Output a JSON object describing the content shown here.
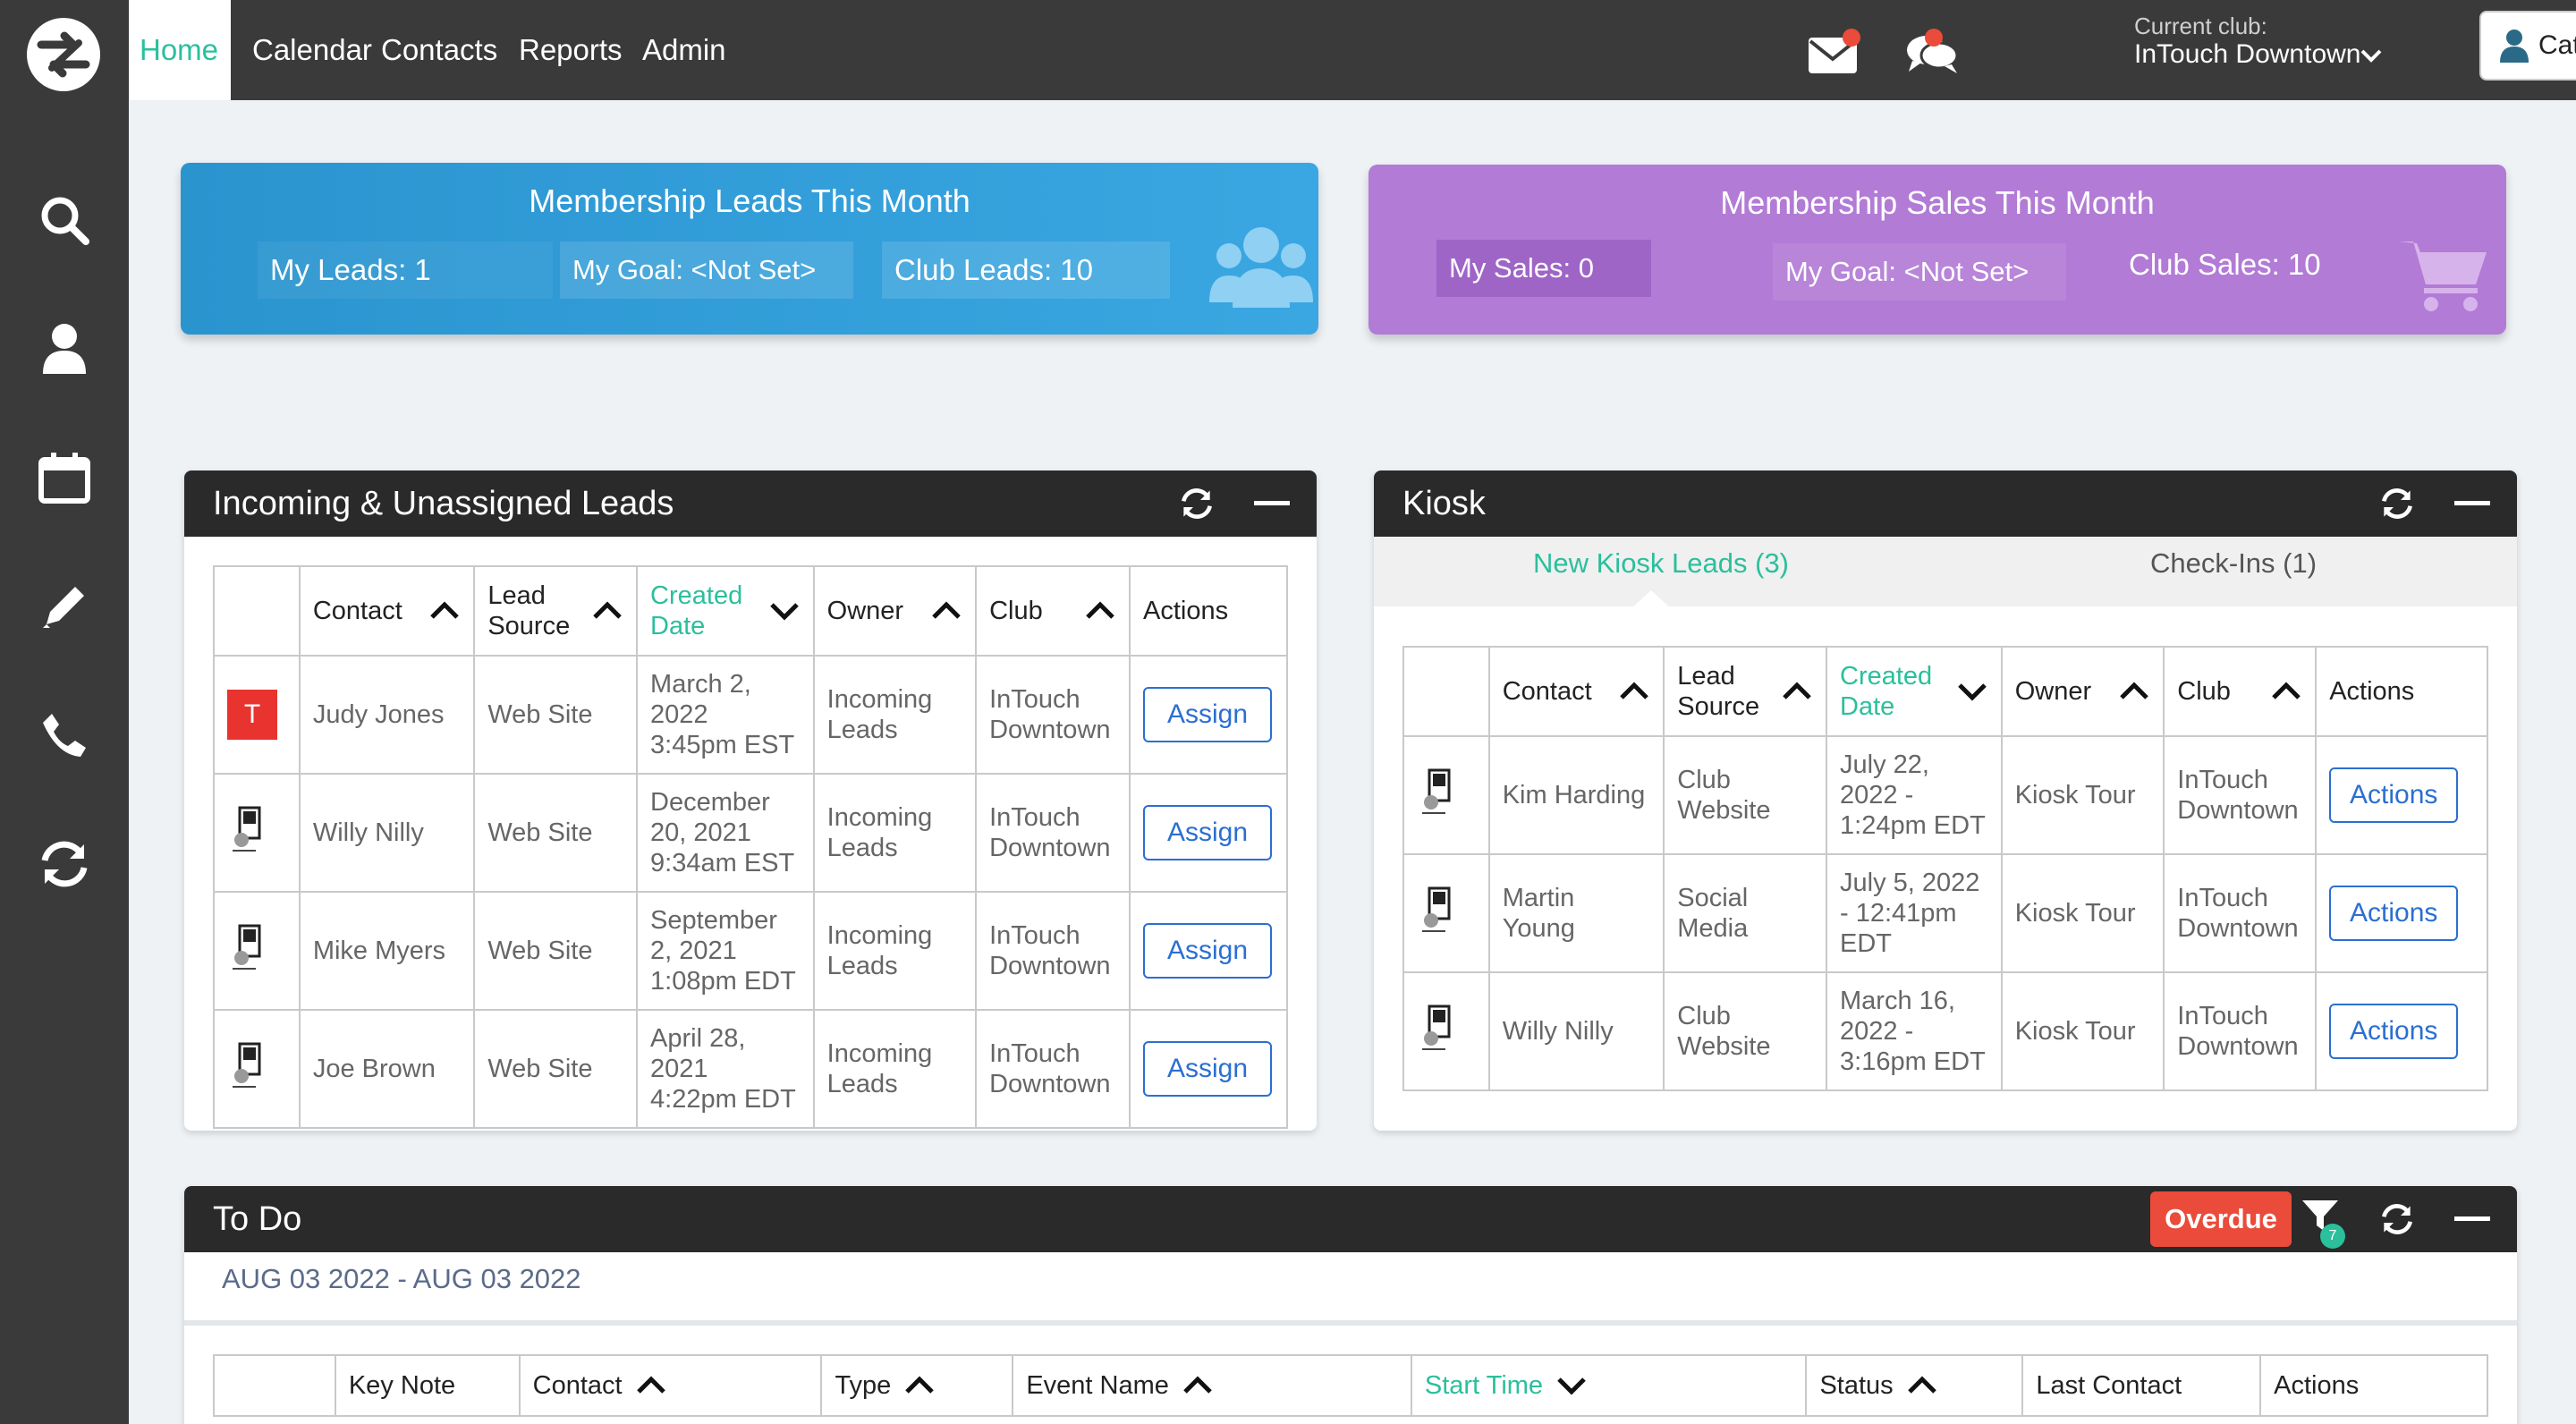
{
  "nav": {
    "items": [
      {
        "label": "Home",
        "active": true
      },
      {
        "label": "Calendar"
      },
      {
        "label": "Contacts"
      },
      {
        "label": "Reports"
      },
      {
        "label": "Admin"
      }
    ]
  },
  "sidebar": {
    "icons": [
      "search-icon",
      "person-icon",
      "calendar-icon",
      "pencil-icon",
      "phone-icon",
      "sync-icon"
    ]
  },
  "header": {
    "club_label": "Current club:",
    "club_value": "InTouch Downtown",
    "user_name": "Cate Tyler",
    "notification_color": "#ea4b3a"
  },
  "leads_card": {
    "title": "Membership Leads This Month",
    "my_leads": "My Leads: 1",
    "my_goal": "My Goal: <Not Set>",
    "club_leads": "Club Leads: 10",
    "icon": "users-icon",
    "color": "#2a94cf"
  },
  "sales_card": {
    "title": "Membership Sales This Month",
    "my_sales": "My Sales: 0",
    "my_goal": "My Goal: <Not Set>",
    "club_sales": "Club Sales: 10",
    "icon": "cart-icon",
    "color": "#b27bd6"
  },
  "incoming": {
    "title": "Incoming & Unassigned Leads",
    "columns": [
      "Contact",
      "Lead Source",
      "Created Date",
      "Owner",
      "Club",
      "Actions"
    ],
    "rows": [
      {
        "contact": "Judy Jones",
        "source": "Web Site",
        "created": "March 2, 2022 3:45pm EST",
        "owner": "Incoming Leads",
        "club": "InTouch Downtown",
        "action": "Assign",
        "avatar": "T"
      },
      {
        "contact": "Willy Nilly",
        "source": "Web Site",
        "created": "December 20, 2021 9:34am EST",
        "owner": "Incoming Leads",
        "club": "InTouch Downtown",
        "action": "Assign"
      },
      {
        "contact": "Mike Myers",
        "source": "Web Site",
        "created": "September 2, 2021 1:08pm EDT",
        "owner": "Incoming Leads",
        "club": "InTouch Downtown",
        "action": "Assign"
      },
      {
        "contact": "Joe Brown",
        "source": "Web Site",
        "created": "April 28, 2021 4:22pm EDT",
        "owner": "Incoming Leads",
        "club": "InTouch Downtown",
        "action": "Assign"
      }
    ]
  },
  "kiosk": {
    "title": "Kiosk",
    "tabs": [
      "New Kiosk Leads (3)",
      "Check-Ins (1)"
    ],
    "columns": [
      "Contact",
      "Lead Source",
      "Created Date",
      "Owner",
      "Club",
      "Actions"
    ],
    "rows": [
      {
        "contact": "Kim Harding",
        "source": "Club Website",
        "created": "July 22, 2022 - 1:24pm EDT",
        "owner": "Kiosk Tour",
        "club": "InTouch Downtown",
        "action": "Actions"
      },
      {
        "contact": "Martin Young",
        "source": "Social Media",
        "created": "July 5, 2022 - 12:41pm EDT",
        "owner": "Kiosk Tour",
        "club": "InTouch Downtown",
        "action": "Actions"
      },
      {
        "contact": "Willy Nilly",
        "source": "Club Website",
        "created": "March 16, 2022 - 3:16pm EDT",
        "owner": "Kiosk Tour",
        "club": "InTouch Downtown",
        "action": "Actions"
      }
    ]
  },
  "todo": {
    "title": "To Do",
    "overdue_label": "Overdue",
    "filter_count": "7",
    "date_range": "AUG 03 2022 - AUG 03 2022",
    "columns": [
      "Key Note",
      "Contact",
      "Type",
      "Event Name",
      "Start Time",
      "Status",
      "Last Contact",
      "Actions"
    ]
  }
}
